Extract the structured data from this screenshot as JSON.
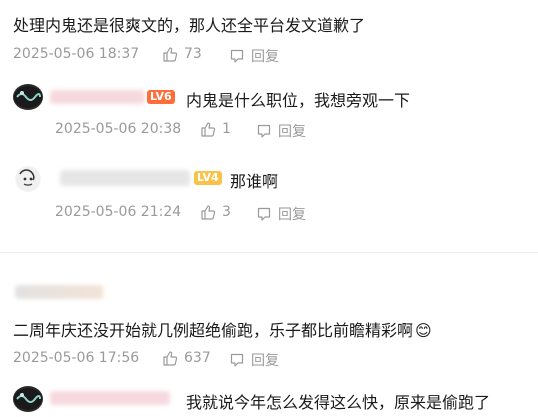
{
  "comments": [
    {
      "text": "处理内鬼还是很爽文的，那人还全平台发文道歉了",
      "timestamp": "2025-05-06 18:37",
      "likes": "73",
      "reply_label": "回复",
      "replies": [
        {
          "level": "LV6",
          "text": "内鬼是什么职位，我想旁观一下",
          "timestamp": "2025-05-06 20:38",
          "likes": "1",
          "reply_label": "回复"
        },
        {
          "level": "LV4",
          "text": "那谁啊",
          "timestamp": "2025-05-06 21:24",
          "likes": "3",
          "reply_label": "回复"
        }
      ]
    },
    {
      "text": "二周年庆还没开始就几例超绝偷跑，乐子都比前瞻精彩啊",
      "emoji": "😊",
      "timestamp": "2025-05-06 17:56",
      "likes": "637",
      "reply_label": "回复",
      "replies": [
        {
          "text": "我就说今年怎么发得这么快，原来是偷跑了"
        }
      ]
    }
  ],
  "colors": {
    "text": "#1a1a1a",
    "meta": "#9a9a9a",
    "lv6": "#ff6d3a",
    "lv4": "#f8c34a",
    "blur_pink": "#f6d9e0"
  }
}
